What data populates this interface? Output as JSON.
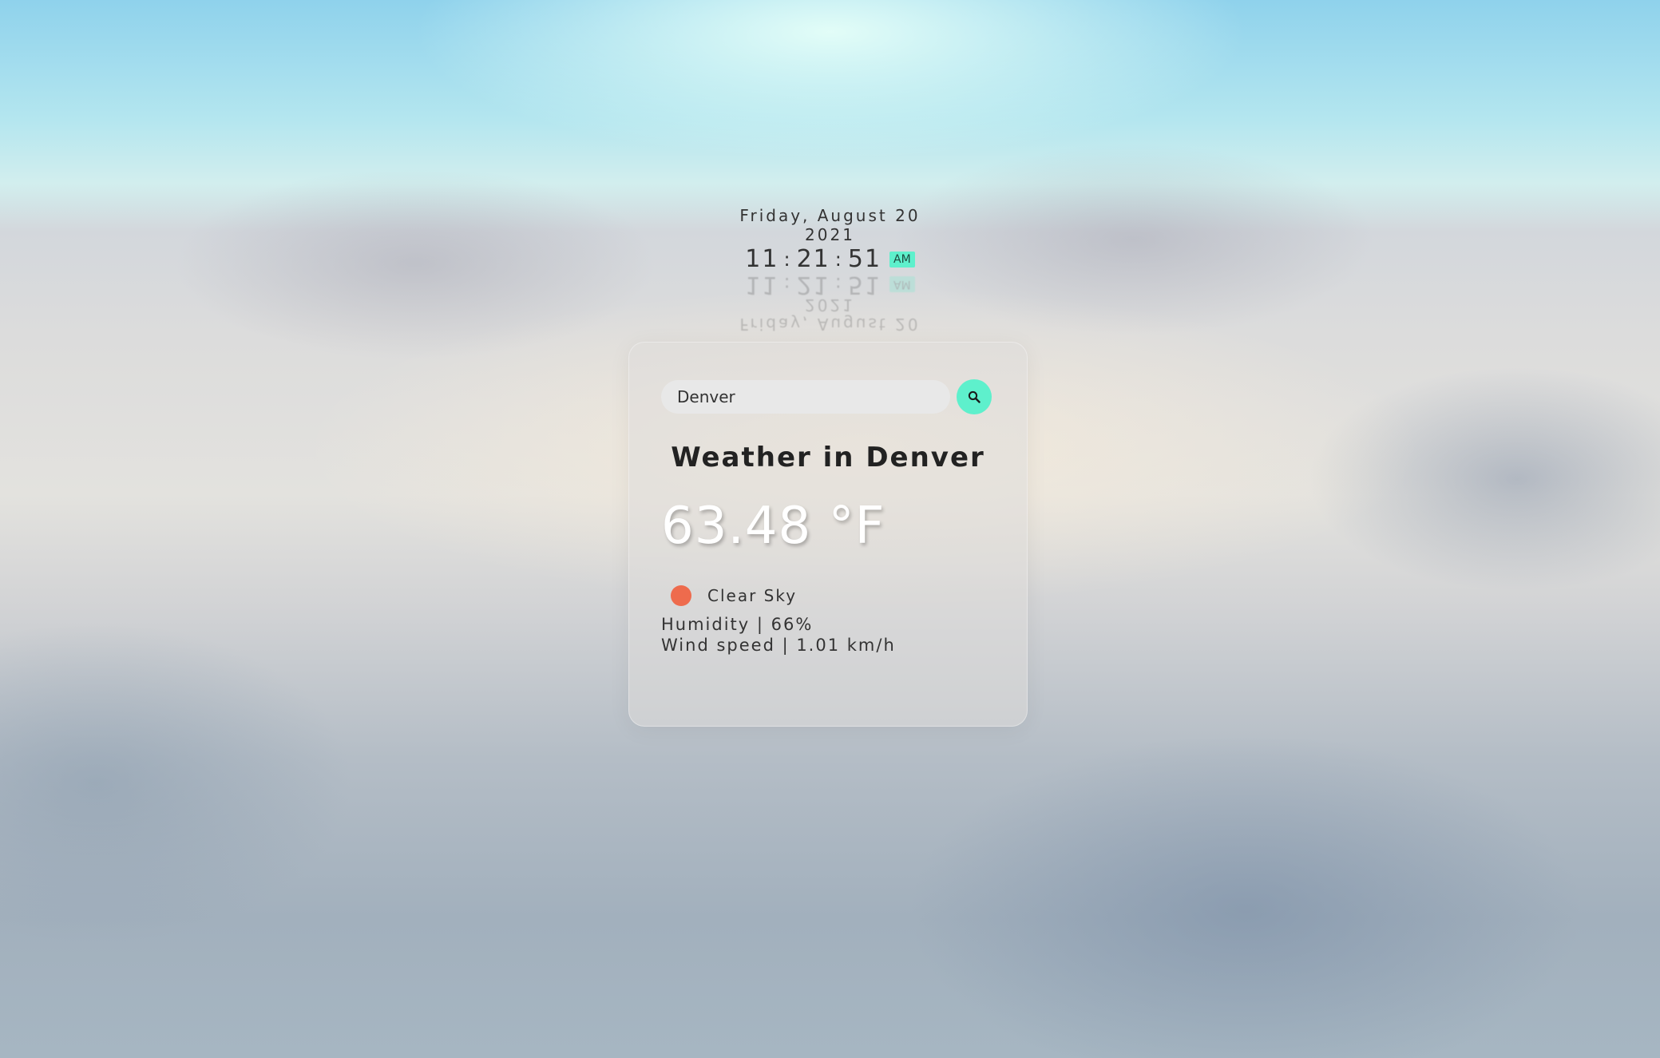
{
  "clock": {
    "date_line": "Friday, August 20",
    "year": "2021",
    "hours": "11",
    "minutes": "21",
    "seconds": "51",
    "separator": ":",
    "ampm": "AM"
  },
  "search": {
    "value": "Denver",
    "placeholder": "Search",
    "button_icon": "search-icon"
  },
  "weather": {
    "title": "Weather in Denver",
    "temperature": "63.48 °F",
    "condition": "Clear Sky",
    "condition_icon": "sun-icon",
    "humidity": "Humidity | 66%",
    "wind": "Wind speed | 1.01 km/h"
  },
  "colors": {
    "accent": "#5ef0cc",
    "sun": "#ee6b4d",
    "text": "#333333"
  }
}
